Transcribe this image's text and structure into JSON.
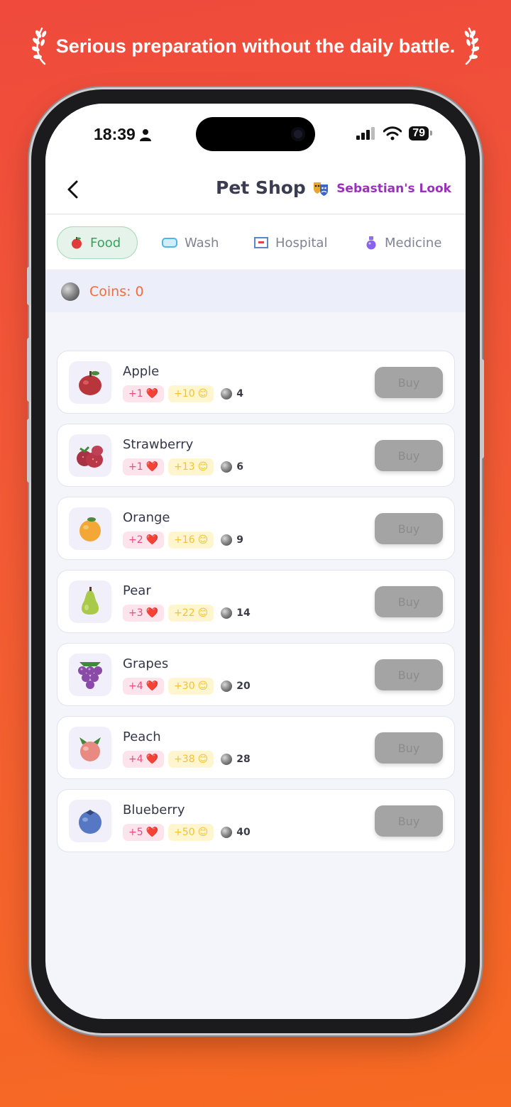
{
  "tagline": "Serious preparation without the daily battle.",
  "status": {
    "time": "18:39",
    "battery": "79"
  },
  "header": {
    "title": "Pet Shop",
    "look_label": "Sebastian's Look"
  },
  "tabs": [
    {
      "label": "Food",
      "active": true,
      "icon": "apple-icon"
    },
    {
      "label": "Wash",
      "active": false,
      "icon": "soap-icon"
    },
    {
      "label": "Hospital",
      "active": false,
      "icon": "hospital-icon"
    },
    {
      "label": "Medicine",
      "active": false,
      "icon": "potion-icon"
    }
  ],
  "coins": {
    "label": "Coins: 0"
  },
  "items": [
    {
      "name": "Apple",
      "love": "+1",
      "happy": "+10",
      "price": "4",
      "buy": "Buy",
      "icon": "apple-icon"
    },
    {
      "name": "Strawberry",
      "love": "+1",
      "happy": "+13",
      "price": "6",
      "buy": "Buy",
      "icon": "strawberry-icon"
    },
    {
      "name": "Orange",
      "love": "+2",
      "happy": "+16",
      "price": "9",
      "buy": "Buy",
      "icon": "orange-icon"
    },
    {
      "name": "Pear",
      "love": "+3",
      "happy": "+22",
      "price": "14",
      "buy": "Buy",
      "icon": "pear-icon"
    },
    {
      "name": "Grapes",
      "love": "+4",
      "happy": "+30",
      "price": "20",
      "buy": "Buy",
      "icon": "grapes-icon"
    },
    {
      "name": "Peach",
      "love": "+4",
      "happy": "+38",
      "price": "28",
      "buy": "Buy",
      "icon": "peach-icon"
    },
    {
      "name": "Blueberry",
      "love": "+5",
      "happy": "+50",
      "price": "40",
      "buy": "Buy",
      "icon": "blueberry-icon"
    }
  ],
  "colors": {
    "accent": "#37a35a",
    "look": "#9b2fc0",
    "coins": "#f26d3b",
    "background_start": "#ef4a3c",
    "background_end": "#f66a22"
  }
}
